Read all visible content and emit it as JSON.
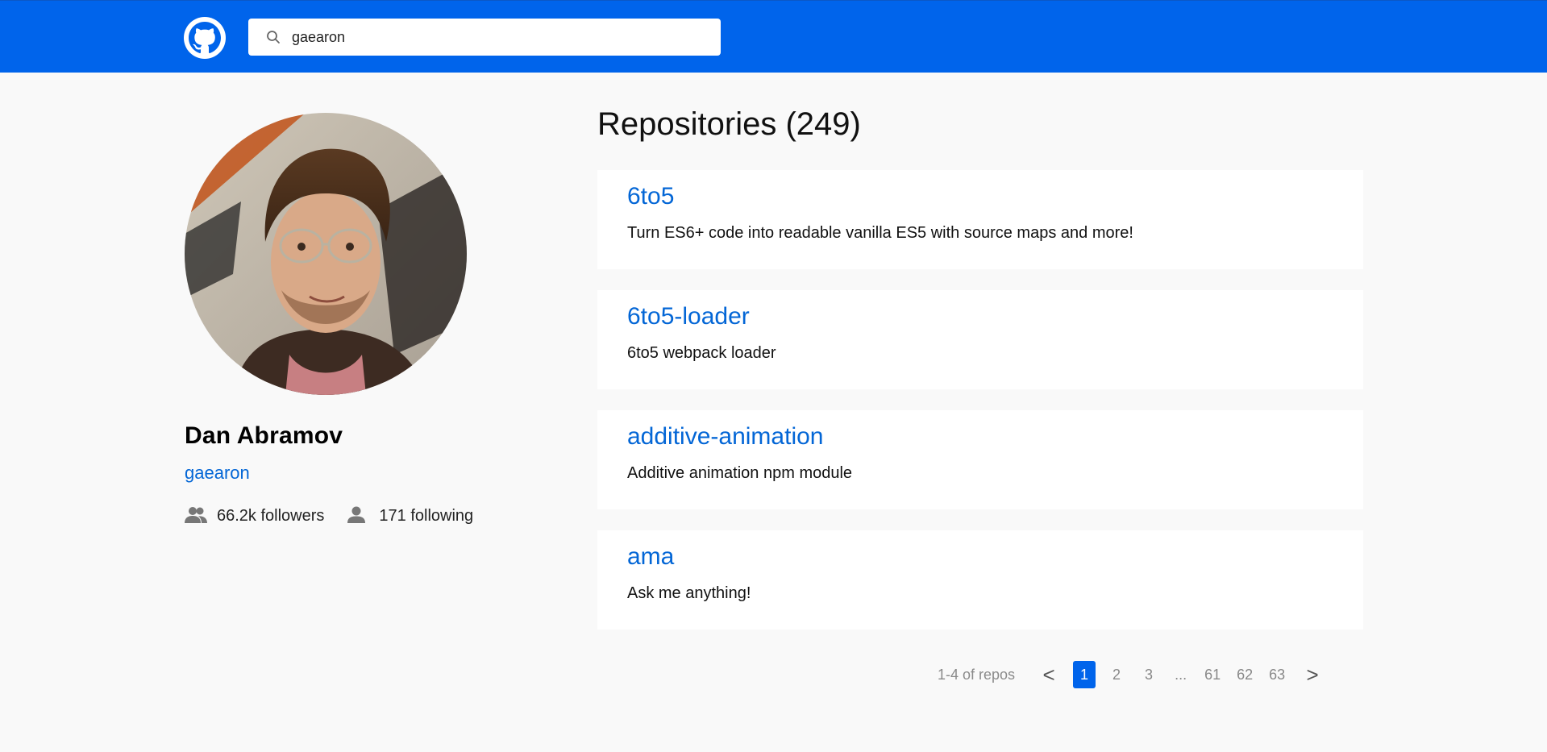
{
  "header": {
    "logo_icon": "github-logo-icon",
    "search": {
      "value": "gaearon",
      "placeholder": "",
      "icon": "search-icon"
    }
  },
  "profile": {
    "name": "Dan Abramov",
    "login": "gaearon",
    "followers_label": "66.2k followers",
    "following_label": "171 following",
    "followers_icon": "people-icon",
    "following_icon": "person-icon"
  },
  "repositories": {
    "title": "Repositories (249)",
    "items": [
      {
        "name": "6to5",
        "description": "Turn ES6+ code into readable vanilla ES5 with source maps and more!"
      },
      {
        "name": "6to5-loader",
        "description": "6to5 webpack loader"
      },
      {
        "name": "additive-animation",
        "description": "Additive animation npm module"
      },
      {
        "name": "ama",
        "description": "Ask me anything!"
      }
    ]
  },
  "pagination": {
    "summary": "1-4 of repos",
    "prev": "<",
    "next": ">",
    "pages": [
      "1",
      "2",
      "3"
    ],
    "ellipsis": "...",
    "last_pages": [
      "61",
      "62",
      "63"
    ],
    "current": "1"
  },
  "colors": {
    "header_bg": "#0064eb",
    "link": "#0366d6",
    "page_bg": "#f9f9f9"
  }
}
